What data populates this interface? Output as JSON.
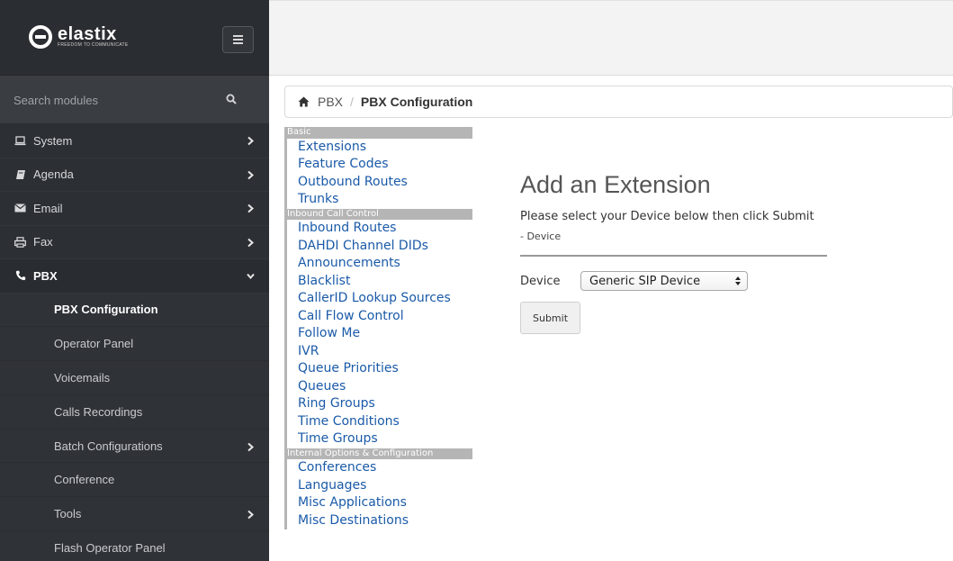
{
  "app": {
    "logo_text": "elastix",
    "logo_tagline": "FREEDOM TO COMMUNICATE"
  },
  "search": {
    "placeholder": "Search modules"
  },
  "sidebar": {
    "items": [
      {
        "label": "System",
        "icon": "laptop-icon"
      },
      {
        "label": "Agenda",
        "icon": "book-icon"
      },
      {
        "label": "Email",
        "icon": "envelope-icon"
      },
      {
        "label": "Fax",
        "icon": "printer-icon"
      },
      {
        "label": "PBX",
        "icon": "phone-icon"
      }
    ],
    "pbx_subitems": [
      {
        "label": "PBX Configuration"
      },
      {
        "label": "Operator Panel"
      },
      {
        "label": "Voicemails"
      },
      {
        "label": "Calls Recordings"
      },
      {
        "label": "Batch Configurations"
      },
      {
        "label": "Conference"
      },
      {
        "label": "Tools"
      },
      {
        "label": "Flash Operator Panel"
      }
    ]
  },
  "breadcrumb": {
    "parent": "PBX",
    "separator": "/",
    "current": "PBX Configuration"
  },
  "pbx_nav": {
    "sections": [
      {
        "title": "Basic",
        "links": [
          "Extensions",
          "Feature Codes",
          "Outbound Routes",
          "Trunks"
        ]
      },
      {
        "title": "Inbound Call Control",
        "links": [
          "Inbound Routes",
          "DAHDI Channel DIDs",
          "Announcements",
          "Blacklist",
          "CallerID Lookup Sources",
          "Call Flow Control",
          "Follow Me",
          "IVR",
          "Queue Priorities",
          "Queues",
          "Ring Groups",
          "Time Conditions",
          "Time Groups"
        ]
      },
      {
        "title": "Internal Options & Configuration",
        "links": [
          "Conferences",
          "Languages",
          "Misc Applications",
          "Misc Destinations"
        ]
      }
    ]
  },
  "content": {
    "title": "Add an Extension",
    "instructions": "Please select your Device below then click Submit",
    "subtitle": "- Device",
    "device_label": "Device",
    "device_value": "Generic SIP Device",
    "submit_label": "Submit"
  },
  "colors": {
    "sidebar_bg": "#2c2f34",
    "link": "#1a5aa8",
    "section_bg": "#b5b5b5"
  }
}
